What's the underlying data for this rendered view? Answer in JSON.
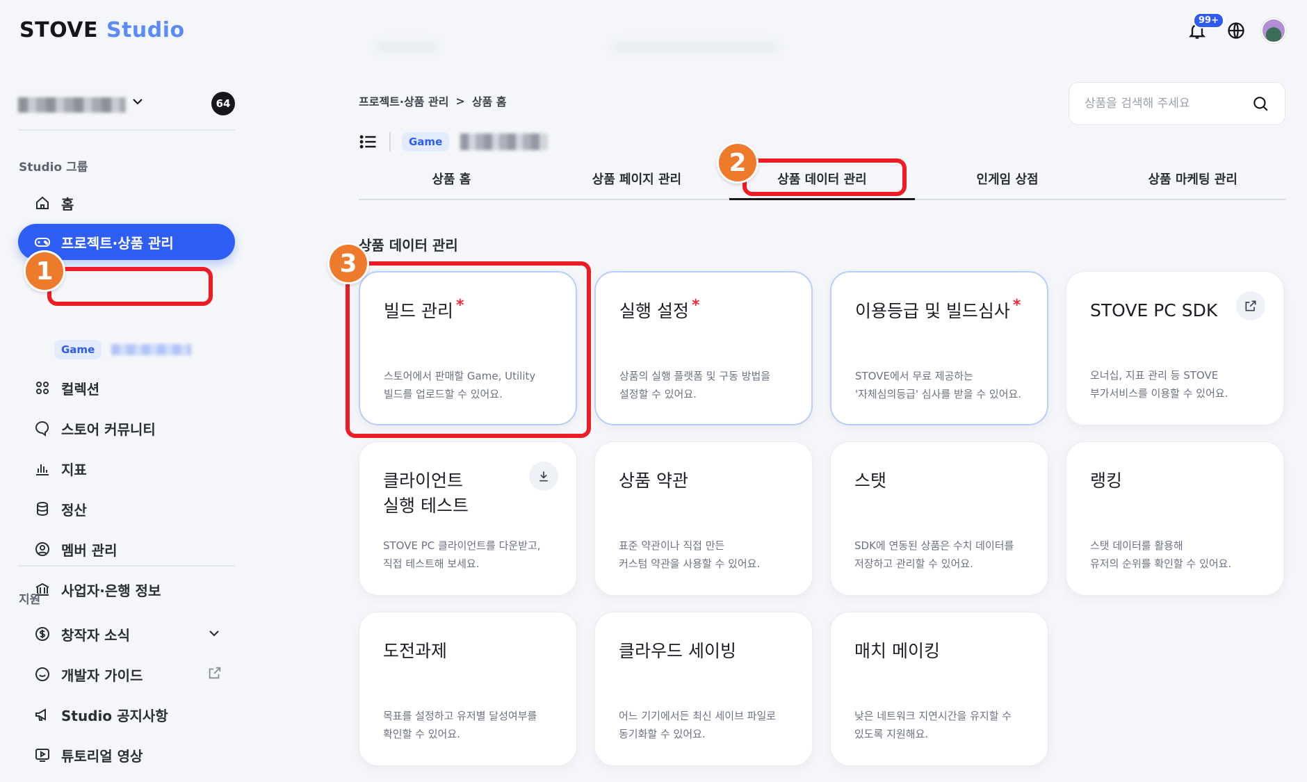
{
  "header": {
    "logo_main": "STOVE",
    "logo_sub": "Studio",
    "notification_badge": "99+"
  },
  "sidebar": {
    "project_count": "64",
    "group_label": "Studio 그룹",
    "items": [
      {
        "label": "홈"
      },
      {
        "label": "프로젝트·상품 관리"
      },
      {
        "label": "컬렉션"
      },
      {
        "label": "스토어 커뮤니티"
      },
      {
        "label": "지표"
      },
      {
        "label": "정산"
      },
      {
        "label": "멤버 관리"
      },
      {
        "label": "사업자·은행 정보"
      }
    ],
    "sub_tag": "Game",
    "support_label": "지원",
    "support_items": [
      {
        "label": "창작자 소식"
      },
      {
        "label": "개발자 가이드"
      },
      {
        "label": "Studio 공지사항"
      },
      {
        "label": "튜토리얼 영상"
      }
    ]
  },
  "breadcrumb": {
    "parent": "프로젝트·상품 관리",
    "separator": ">",
    "current": "상품 홈"
  },
  "search": {
    "placeholder": "상품을 검색해 주세요"
  },
  "product": {
    "tag": "Game"
  },
  "tabs": [
    {
      "label": "상품 홈"
    },
    {
      "label": "상품 페이지 관리"
    },
    {
      "label": "상품 데이터 관리"
    },
    {
      "label": "인게임 상점"
    },
    {
      "label": "상품 마케팅 관리"
    }
  ],
  "section_title": "상품 데이터 관리",
  "cards": [
    {
      "title": "빌드 관리",
      "required": "*",
      "desc": "스토어에서 판매할 Game, Utility\n빌드를 업로드할 수 있어요."
    },
    {
      "title": "실행 설정",
      "required": "*",
      "desc": "상품의 실행 플랫폼 및 구동 방법을\n설정할 수 있어요."
    },
    {
      "title": "이용등급 및 빌드심사",
      "required": "*",
      "desc": "STOVE에서 무료 제공하는\n'자체심의등급' 심사를 받을 수 있어요."
    },
    {
      "title": "STOVE PC SDK",
      "desc": "오너십, 지표 관리 등 STOVE\n부가서비스를 이용할 수 있어요."
    },
    {
      "title": "클라이언트\n실행 테스트",
      "desc": "STOVE PC 클라이언트를 다운받고,\n직접 테스트해 보세요."
    },
    {
      "title": "상품 약관",
      "desc": "표준 약관이나 직접 만든\n커스텀 약관을 사용할 수 있어요."
    },
    {
      "title": "스탯",
      "desc": "SDK에 연동된 상품은 수치 데이터를\n저장하고 관리할 수 있어요."
    },
    {
      "title": "랭킹",
      "desc": "스탯 데이터를 활용해\n유저의 순위를 확인할 수 있어요."
    },
    {
      "title": "도전과제",
      "desc": "목표를 설정하고 유저별 달성여부를\n확인할 수 있어요."
    },
    {
      "title": "클라우드 세이빙",
      "desc": "어느 기기에서든 최신 세이브 파일로\n동기화할 수 있어요."
    },
    {
      "title": "매치 메이킹",
      "desc": "낮은 네트워크 지연시간을 유지할 수\n있도록 지원해요."
    }
  ],
  "annotations": [
    "1",
    "2",
    "3"
  ]
}
